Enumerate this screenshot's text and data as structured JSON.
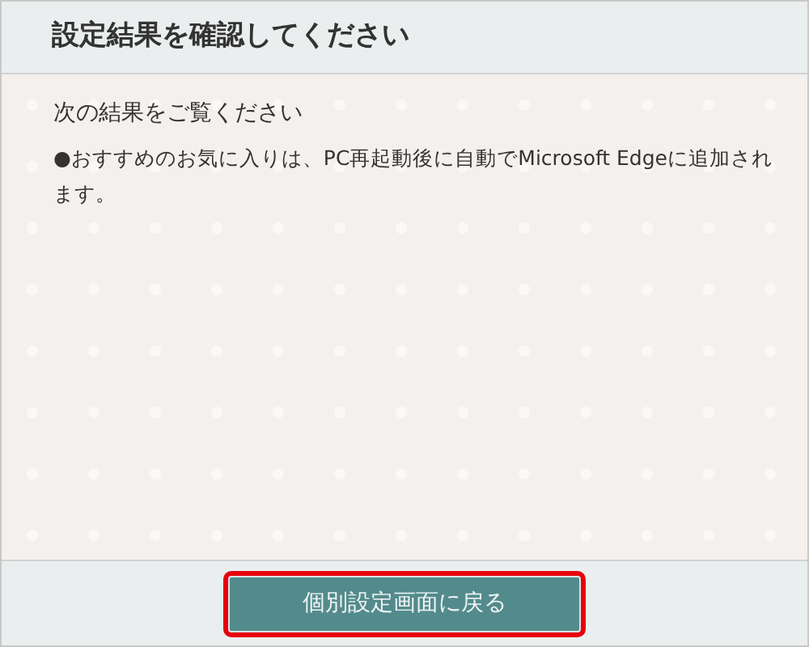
{
  "header": {
    "title": "設定結果を確認してください"
  },
  "body": {
    "lead": "次の結果をご覧ください",
    "notes": [
      "●おすすめのお気に入りは、PC再起動後に自動でMicrosoft Edgeに追加されます。"
    ]
  },
  "footer": {
    "button": {
      "label": "個別設定画面に戻る",
      "highlighted": true
    }
  }
}
